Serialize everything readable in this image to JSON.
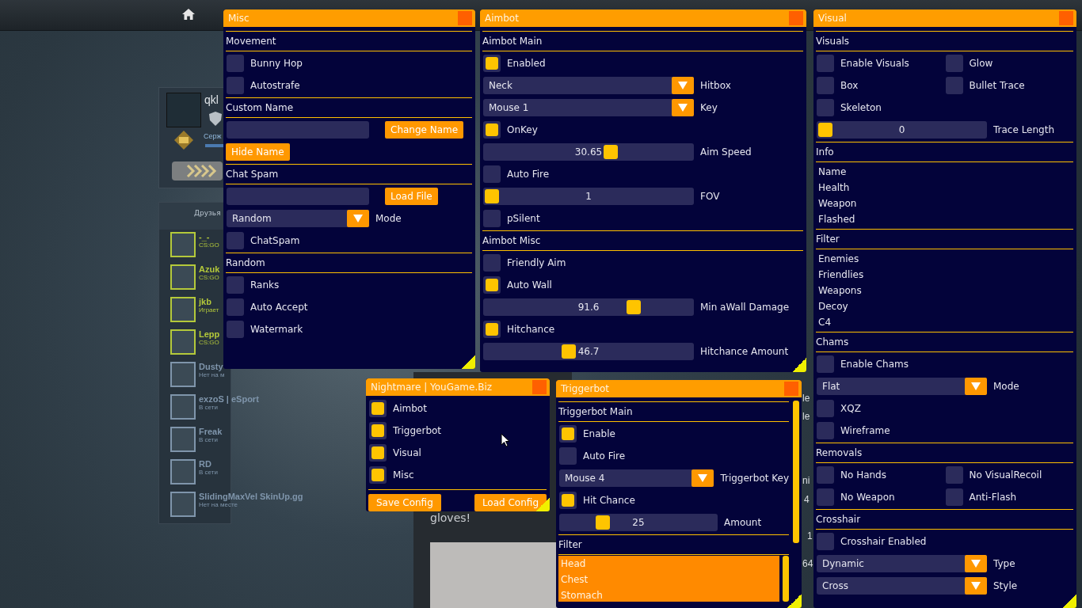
{
  "profile": {
    "name": "qkl",
    "rank": "Серж"
  },
  "friends": {
    "header": "Друзья",
    "items": [
      {
        "name": "-_-",
        "status": "CS:GO",
        "color": "#b4c93a"
      },
      {
        "name": "Azuk",
        "status": "CS:GO",
        "color": "#b4c93a"
      },
      {
        "name": "jkb",
        "status": "Играет",
        "color": "#b4c93a"
      },
      {
        "name": "Lepp",
        "status": "CS:GO",
        "color": "#b4c93a"
      },
      {
        "name": "Dusty",
        "status": "Нет на м",
        "color": "#7f95ab"
      },
      {
        "name": "exzoS | eSport",
        "status": "В сети",
        "color": "#7f95ab"
      },
      {
        "name": "Freak",
        "status": "В сети",
        "color": "#7f95ab"
      },
      {
        "name": "RD",
        "status": "В сети",
        "color": "#7f95ab"
      },
      {
        "name": "SlidingMaxVel SkinUp.gg",
        "status": "Нет на месте",
        "color": "#7f95ab"
      }
    ]
  },
  "feed": {
    "text": "gloves!",
    "fragments": [
      "le",
      "le",
      "ni",
      "4",
      "1",
      "64"
    ]
  },
  "windows": [
    {
      "title": "Misc",
      "sections": [
        {
          "heading": "Movement",
          "controls": [
            {
              "kind": "checkbox",
              "label": "Bunny Hop",
              "checked": false
            },
            {
              "kind": "checkbox",
              "label": "Autostrafe",
              "checked": false
            }
          ]
        },
        {
          "heading": "Custom Name",
          "controls": [
            {
              "kind": "field_button",
              "button": "Change Name"
            },
            {
              "kind": "button",
              "label": "Hide Name"
            }
          ]
        },
        {
          "heading": "Chat Spam",
          "controls": [
            {
              "kind": "field_button",
              "button": "Load File"
            },
            {
              "kind": "dropdown",
              "option": "Random",
              "caption": "Mode"
            },
            {
              "kind": "checkbox",
              "label": "ChatSpam",
              "checked": false
            }
          ]
        },
        {
          "heading": "Random",
          "controls": [
            {
              "kind": "checkbox",
              "label": "Ranks",
              "checked": false
            },
            {
              "kind": "checkbox",
              "label": "Auto Accept",
              "checked": false
            },
            {
              "kind": "checkbox",
              "label": "Watermark",
              "checked": false
            }
          ]
        }
      ]
    },
    {
      "title": "Aimbot",
      "sections": [
        {
          "heading": "Aimbot Main",
          "controls": [
            {
              "kind": "checkbox",
              "label": "Enabled",
              "checked": true
            },
            {
              "kind": "dropdown",
              "option": "Neck",
              "caption": "Hitbox"
            },
            {
              "kind": "dropdown",
              "option": "Mouse 1",
              "caption": "Key"
            },
            {
              "kind": "checkbox",
              "label": "OnKey",
              "checked": true
            },
            {
              "kind": "slider",
              "reading": "30.65",
              "level": 0.62,
              "label": "Aim Speed"
            },
            {
              "kind": "checkbox",
              "label": "Auto Fire",
              "checked": false
            },
            {
              "kind": "slider",
              "reading": "1",
              "level": 0,
              "label": "FOV"
            },
            {
              "kind": "checkbox",
              "label": "pSilent",
              "checked": false
            }
          ]
        },
        {
          "heading": "Aimbot Misc",
          "controls": [
            {
              "kind": "checkbox",
              "label": "Friendly Aim",
              "checked": false
            },
            {
              "kind": "checkbox",
              "label": "Auto Wall",
              "checked": true
            },
            {
              "kind": "slider",
              "reading": "91.6",
              "level": 0.74,
              "label": "Min aWall Damage"
            },
            {
              "kind": "checkbox",
              "label": "Hitchance",
              "checked": true
            },
            {
              "kind": "slider",
              "reading": "46.7",
              "level": 0.4,
              "label": "Hitchance Amount"
            }
          ]
        }
      ]
    },
    {
      "title": "Visual",
      "sections": [
        {
          "heading": "Visuals",
          "controls": [
            {
              "kind": "checkgrid",
              "items": [
                {
                  "label": "Enable Visuals",
                  "checked": false
                },
                {
                  "label": "Glow",
                  "checked": false
                },
                {
                  "label": "Box",
                  "checked": false
                },
                {
                  "label": "Bullet Trace",
                  "checked": false
                },
                {
                  "label": "Skeleton",
                  "checked": false
                }
              ]
            },
            {
              "kind": "slider",
              "reading": "0",
              "level": 0,
              "label": "Trace Length"
            }
          ]
        },
        {
          "heading": "Info",
          "controls": [
            {
              "kind": "textlist",
              "items": [
                "Name",
                "Health",
                "Weapon",
                "Flashed"
              ]
            }
          ]
        },
        {
          "heading": "Filter",
          "controls": [
            {
              "kind": "textlist",
              "items": [
                "Enemies",
                "Friendlies",
                "Weapons",
                "Decoy",
                "C4"
              ]
            }
          ]
        },
        {
          "heading": "Chams",
          "controls": [
            {
              "kind": "checkbox",
              "label": "Enable Chams",
              "checked": false
            },
            {
              "kind": "dropdown",
              "option": "Flat",
              "caption": "Mode"
            },
            {
              "kind": "checkbox",
              "label": "XQZ",
              "checked": false
            },
            {
              "kind": "checkbox",
              "label": "Wireframe",
              "checked": false
            }
          ]
        },
        {
          "heading": "Removals",
          "controls": [
            {
              "kind": "checkgrid",
              "items": [
                {
                  "label": "No Hands",
                  "checked": false
                },
                {
                  "label": "No VisualRecoil",
                  "checked": false
                },
                {
                  "label": "No Weapon",
                  "checked": false
                },
                {
                  "label": "Anti-Flash",
                  "checked": false
                }
              ]
            }
          ]
        },
        {
          "heading": "Crosshair",
          "controls": [
            {
              "kind": "checkbox",
              "label": "Crosshair Enabled",
              "checked": false
            },
            {
              "kind": "dropdown",
              "option": "Dynamic",
              "caption": "Type"
            },
            {
              "kind": "dropdown",
              "option": "Cross",
              "caption": "Style"
            }
          ]
        }
      ]
    },
    {
      "title": "Nightmare | YouGame.Biz",
      "sections": [
        {
          "controls": [
            {
              "kind": "checkbox",
              "label": "Aimbot",
              "checked": true
            },
            {
              "kind": "checkbox",
              "label": "Triggerbot",
              "checked": true
            },
            {
              "kind": "checkbox",
              "label": "Visual",
              "checked": true
            },
            {
              "kind": "checkbox",
              "label": "Misc",
              "checked": true
            },
            {
              "kind": "buttons",
              "items": [
                "Save Config",
                "Load Config"
              ]
            }
          ]
        }
      ]
    },
    {
      "title": "Triggerbot",
      "sections": [
        {
          "heading": "Triggerbot Main",
          "controls": [
            {
              "kind": "checkbox",
              "label": "Enable",
              "checked": true
            },
            {
              "kind": "checkbox",
              "label": "Auto Fire",
              "checked": false
            },
            {
              "kind": "dropdown",
              "option": "Mouse 4",
              "caption": "Triggerbot Key"
            },
            {
              "kind": "checkbox",
              "label": "Hit Chance",
              "checked": true
            },
            {
              "kind": "slider",
              "reading": "25",
              "level": 0.25,
              "label": "Amount"
            }
          ]
        },
        {
          "heading": "Filter",
          "controls": [
            {
              "kind": "filterlist",
              "items": [
                "Head",
                "Chest",
                "Stomach"
              ]
            }
          ]
        }
      ]
    }
  ]
}
